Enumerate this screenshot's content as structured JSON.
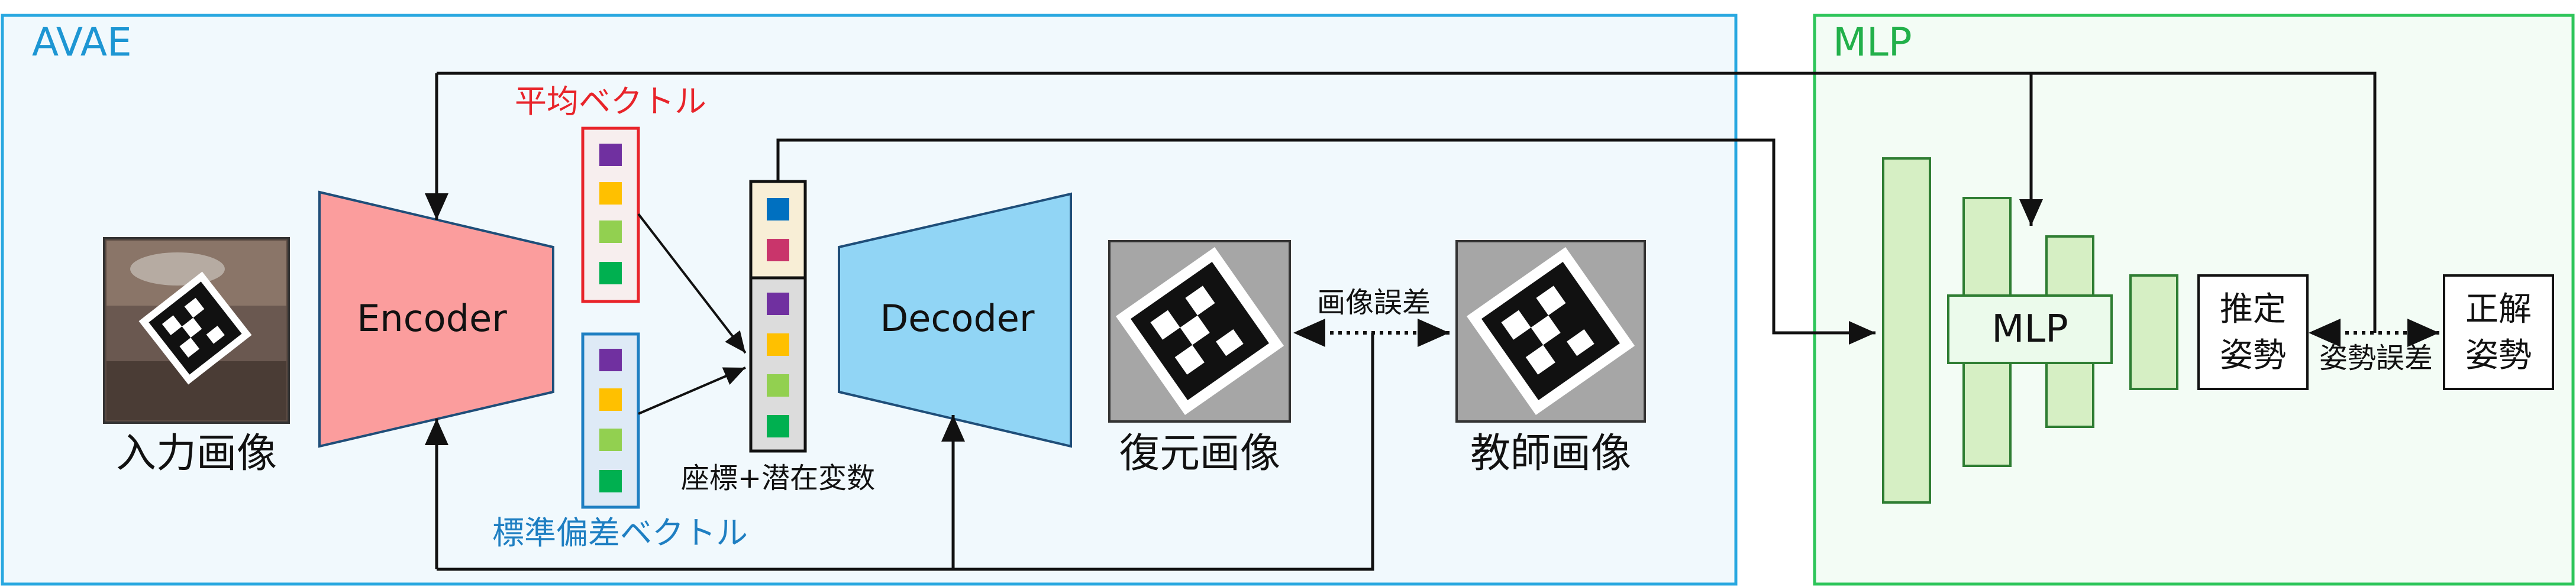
{
  "avae_section": {
    "title": "AVAE"
  },
  "mlp_section": {
    "title": "MLP"
  },
  "input_image": {
    "label": "入力画像"
  },
  "encoder": {
    "label": "Encoder"
  },
  "decoder": {
    "label": "Decoder"
  },
  "mean_vector": {
    "label": "平均ベクトル"
  },
  "std_vector": {
    "label": "標準偏差ベクトル"
  },
  "latent_vector": {
    "label": "座標+潜在変数"
  },
  "reconstructed_image": {
    "label": "復元画像"
  },
  "teacher_image": {
    "label": "教師画像"
  },
  "image_error": {
    "label": "画像誤差"
  },
  "mlp_block": {
    "label": "MLP"
  },
  "estimated_pose": {
    "line1": "推定",
    "line2": "姿勢"
  },
  "true_pose": {
    "line1": "正解",
    "line2": "姿勢"
  },
  "pose_error": {
    "label": "姿勢誤差"
  },
  "colors": {
    "avae_border": "#29a8e0",
    "avae_fill": "#f1f9fd",
    "mlp_border": "#2ec55a",
    "mlp_fill": "#f3fcf5",
    "encoder": "#fb9d9d",
    "decoder": "#91d5f5",
    "mean_label": "#e8242a",
    "std_label": "#1f7fc2",
    "cell_purple": "#7030a0",
    "cell_orange": "#ffc000",
    "cell_lightgreen": "#92d050",
    "cell_green": "#00b050",
    "cell_blue": "#0070c0",
    "cell_crimson": "#c9356b",
    "mlp_layer": "#d6efc4"
  }
}
